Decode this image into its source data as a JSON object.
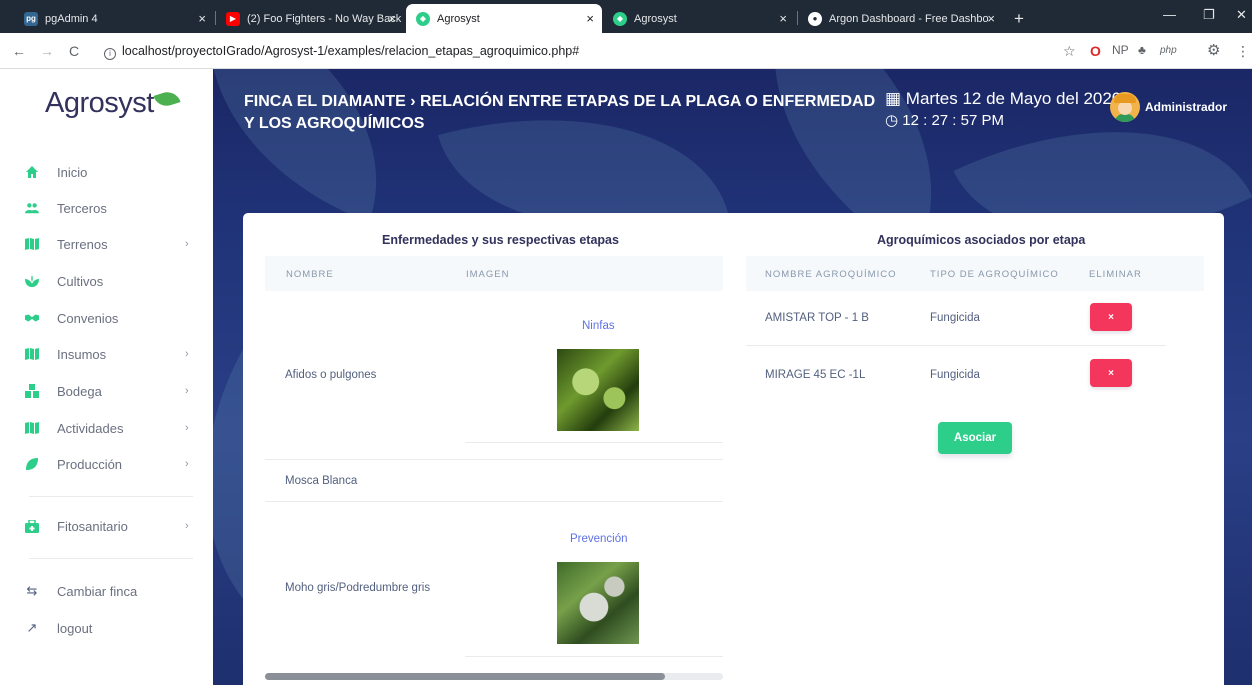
{
  "browser": {
    "tabs": [
      {
        "title": "pgAdmin 4",
        "active": false
      },
      {
        "title": "(2) Foo Fighters - No Way Back (",
        "active": false
      },
      {
        "title": "Agrosyst",
        "active": true
      },
      {
        "title": "Agrosyst",
        "active": false
      },
      {
        "title": "Argon Dashboard - Free Dashbo",
        "active": false
      }
    ],
    "url": "localhost/proyectoIGrado/Agrosyst-1/examples/relacion_etapas_agroquimico.php#",
    "extensions": [
      "NP",
      "php"
    ]
  },
  "sidebar": {
    "logo": "Agrosyst",
    "items": [
      {
        "label": "Inicio",
        "icon": "home-icon",
        "chevron": false
      },
      {
        "label": "Terceros",
        "icon": "users-icon",
        "chevron": false
      },
      {
        "label": "Terrenos",
        "icon": "map-icon",
        "chevron": true
      },
      {
        "label": "Cultivos",
        "icon": "plant-icon",
        "chevron": false
      },
      {
        "label": "Convenios",
        "icon": "handshake-icon",
        "chevron": false
      },
      {
        "label": "Insumos",
        "icon": "map-icon",
        "chevron": true
      },
      {
        "label": "Bodega",
        "icon": "boxes-icon",
        "chevron": true
      },
      {
        "label": "Actividades",
        "icon": "map-icon",
        "chevron": true
      },
      {
        "label": "Producción",
        "icon": "leaf-icon",
        "chevron": true
      }
    ],
    "fito": {
      "label": "Fitosanitario",
      "icon": "medkit-icon",
      "chevron": true
    },
    "bottom": [
      {
        "label": "Cambiar finca",
        "icon": "exchange-icon"
      },
      {
        "label": "logout",
        "icon": "logout-icon"
      }
    ],
    "colors": {
      "green": "#2dce89",
      "text": "#6b7080"
    }
  },
  "header": {
    "title": "FINCA EL DIAMANTE › RELACIÓN ENTRE ETAPAS DE LA PLAGA O ENFERMEDAD Y LOS AGROQUÍMICOS",
    "date": "Martes 12 de Mayo del 2020",
    "time": "12 : 27 : 57 PM",
    "user": "Administrador"
  },
  "left_table": {
    "title": "Enfermedades y sus respectivas etapas",
    "columns": [
      "NOMBRE",
      "IMAGEN"
    ],
    "rows": [
      {
        "name": "Afidos o pulgones",
        "stage": "Ninfas",
        "image": "aphid-photo"
      },
      {
        "name": "Mosca Blanca",
        "stage": "",
        "image": ""
      },
      {
        "name": "Moho gris/Podredumbre gris",
        "stage": "Prevención",
        "image": "mold-photo"
      }
    ]
  },
  "right_table": {
    "title": "Agroquímicos asociados por etapa",
    "columns": [
      "NOMBRE AGROQUÍMICO",
      "TIPO DE AGROQUÍMICO",
      "ELIMINAR"
    ],
    "rows": [
      {
        "name": "AMISTAR TOP - 1 B",
        "type": "Fungicida",
        "delete": "×"
      },
      {
        "name": "MIRAGE 45 EC -1L",
        "type": "Fungicida",
        "delete": "×"
      }
    ],
    "button": "Asociar",
    "colors": {
      "delete": "#f5365c",
      "asociar": "#2dce89"
    }
  }
}
